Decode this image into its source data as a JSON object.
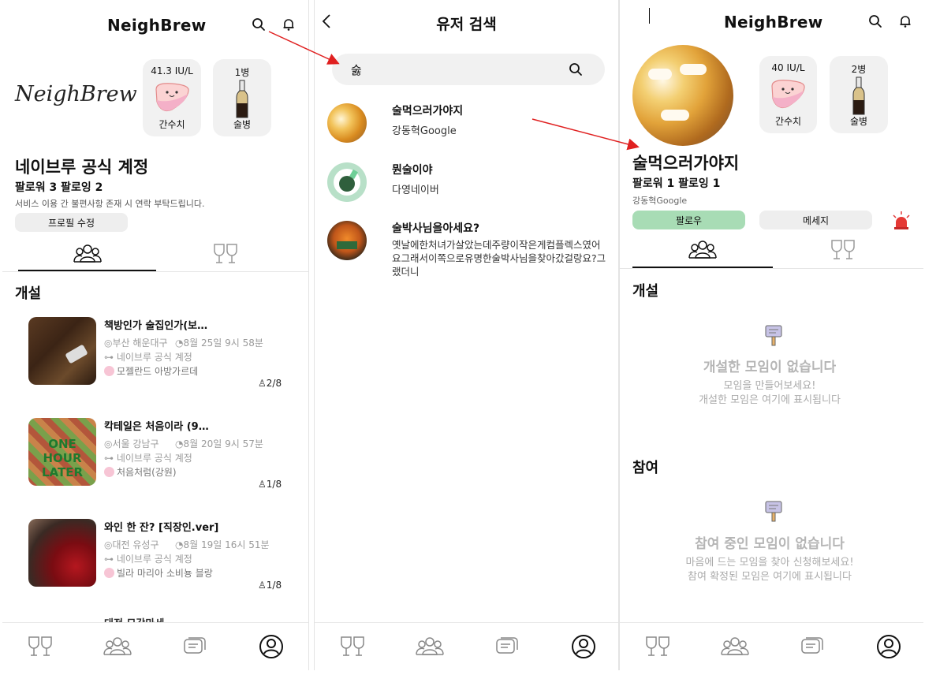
{
  "profile": {
    "app_title": "NeighBrew",
    "logo_text": "NeighBrew",
    "liver_value": "41.3 IU/L",
    "liver_label": "간수치",
    "bottle_value": "1병",
    "bottle_label": "술병",
    "name": "네이브루 공식 계정",
    "follow": "팔로워 3 팔로잉 2",
    "bio": "서비스 이용 간 불편사항 존재 시 연락 부탁드립니다.",
    "edit_button": "프로필 수정",
    "section_created": "개설",
    "meetings": [
      {
        "title": "책방인가 술집인가(보…",
        "location": "부산 해운대구",
        "time": "8월 25일 9시 58분",
        "host": "네이브루 공식 계정",
        "drink": "모젤란드 아방가르데",
        "count": "2/8"
      },
      {
        "title": "칵테일은 처음이라 (9…",
        "location": "서울 강남구",
        "time": "8월 20일 9시 57분",
        "host": "네이브루 공식 계정",
        "drink": "처음처럼(강원)",
        "count": "1/8"
      },
      {
        "title": "와인 한 잔? [직장인.ver]",
        "location": "대전 유성구",
        "time": "8월 19일 16시 51분",
        "host": "네이브루 공식 계정",
        "drink": "빌라 마리아 소비뇽 블랑",
        "count": "1/8"
      }
    ],
    "partial_title": "대전 모각마세"
  },
  "search": {
    "title": "유저 검색",
    "query": "숧",
    "results": [
      {
        "name": "술먹으러가야지",
        "sub": "강동혁Google"
      },
      {
        "name": "뭔술이야",
        "sub": "다영네이버"
      },
      {
        "name": "술박사님을아세요?",
        "sub": "옛날에한처녀가살았는데주량이작은게컴플렉스였어요그래서이쪽으로유명한술박사님을찾아갔걸랑요?그랬더니"
      }
    ]
  },
  "other": {
    "app_title": "NeighBrew",
    "liver_value": "40 IU/L",
    "liver_label": "간수치",
    "bottle_value": "2병",
    "bottle_label": "술병",
    "name": "술먹으러가야지",
    "follow": "팔로워 1 팔로잉 1",
    "sub": "강동혁Google",
    "follow_button": "팔로우",
    "message_button": "메세지",
    "section_created": "개설",
    "empty_created_title": "개설한 모임이 없습니다",
    "empty_created_desc1": "모임을 만들어보세요!",
    "empty_created_desc2": "개설한 모임은 여기에 표시됩니다",
    "section_joined": "참여",
    "empty_joined_title": "참여 중인 모임이 없습니다",
    "empty_joined_desc1": "마음에 드는 모임을 찾아 신청해보세요!",
    "empty_joined_desc2": "참여 확정된 모임은 여기에 표시됩니다"
  },
  "colors": {
    "arrow": "#e02020",
    "follow_green": "#a8dcb5",
    "pill_gray": "#eeeeee",
    "card_gray": "#f1f1f1"
  }
}
